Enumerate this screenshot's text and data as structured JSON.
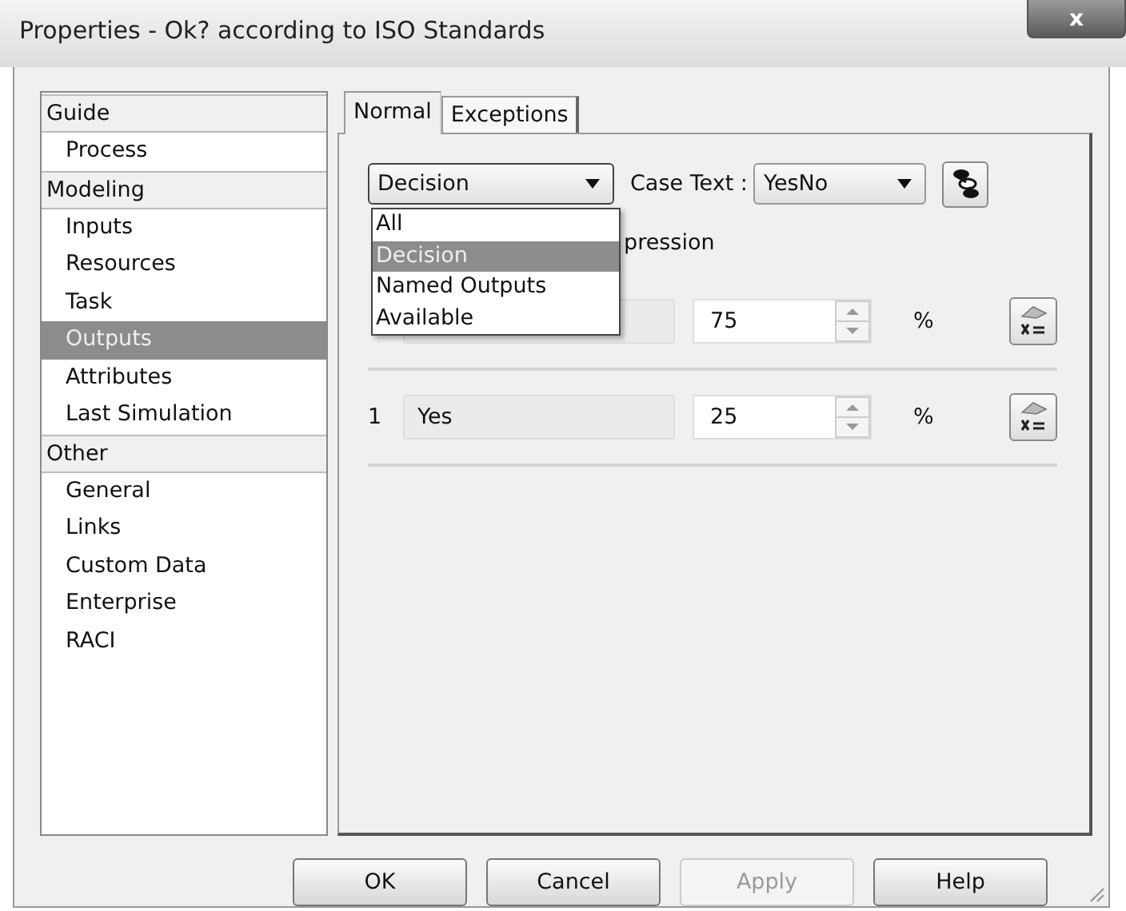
{
  "window": {
    "title": "Properties - Ok? according to ISO Standards",
    "close": "x"
  },
  "sidebar": {
    "groups": [
      {
        "label": "Guide",
        "items": [
          {
            "label": "Process",
            "selected": false
          }
        ]
      },
      {
        "label": "Modeling",
        "items": [
          {
            "label": "Inputs",
            "selected": false
          },
          {
            "label": "Resources",
            "selected": false
          },
          {
            "label": "Task",
            "selected": false
          },
          {
            "label": "Outputs",
            "selected": true
          },
          {
            "label": "Attributes",
            "selected": false
          },
          {
            "label": "Last Simulation",
            "selected": false
          }
        ]
      },
      {
        "label": "Other",
        "items": [
          {
            "label": "General",
            "selected": false
          },
          {
            "label": "Links",
            "selected": false
          },
          {
            "label": "Custom Data",
            "selected": false
          },
          {
            "label": "Enterprise",
            "selected": false
          },
          {
            "label": "RACI",
            "selected": false
          }
        ]
      }
    ]
  },
  "tabs": [
    {
      "label": "Normal",
      "selected": true
    },
    {
      "label": "Exceptions",
      "selected": false
    }
  ],
  "type_dropdown": {
    "value": "Decision",
    "expanded": true,
    "options": [
      {
        "label": "All",
        "selected": false
      },
      {
        "label": "Decision",
        "selected": true
      },
      {
        "label": "Named Outputs",
        "selected": false
      },
      {
        "label": "Available",
        "selected": false
      }
    ]
  },
  "case_text": {
    "label": "Case Text :",
    "value": "YesNo"
  },
  "expression_label": "pression",
  "rows": [
    {
      "value": "75",
      "unit": "%"
    },
    {
      "index": "1",
      "name": "Yes",
      "value": "25",
      "unit": "%"
    }
  ],
  "buttons": [
    {
      "label": "OK",
      "disabled": false
    },
    {
      "label": "Cancel",
      "disabled": false
    },
    {
      "label": "Apply",
      "disabled": true
    },
    {
      "label": "Help",
      "disabled": false
    }
  ]
}
